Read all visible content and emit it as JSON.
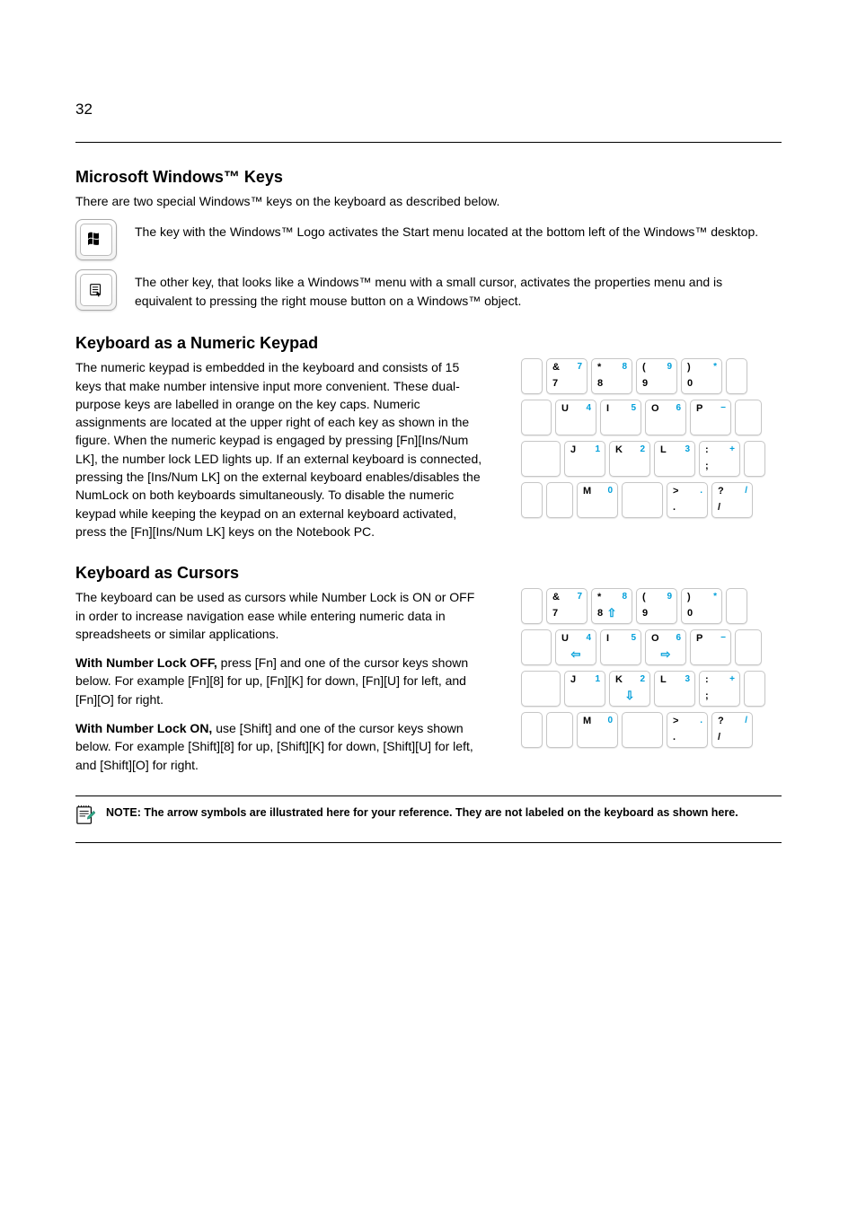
{
  "page_number": "32",
  "sections": {
    "ms_windows_keys": {
      "title": "Microsoft Windows™ Keys",
      "intro": "There are two special Windows™ keys on the keyboard as described below.",
      "win_key_text": "The key with the Windows™ Logo activates the Start menu located at the bottom left of the Windows™ desktop.",
      "menu_key_text": "The other key, that looks like a Windows™ menu with a small cursor, activates the properties menu and is equivalent to pressing the right mouse button on a Windows™ object."
    },
    "numeric_keypad": {
      "title": "Keyboard as a Numeric Keypad",
      "text": "The numeric keypad is embedded in the keyboard and consists of 15 keys that make number intensive input more convenient. These dual-purpose keys are labelled in orange on the key caps. Numeric assignments are located at the upper right of each key as shown in the figure. When the numeric keypad is engaged by pressing [Fn][Ins/Num LK], the number lock LED lights up. If an external keyboard is connected, pressing the [Ins/Num LK] on the external keyboard enables/disables the NumLock on both keyboards simultaneously. To disable the numeric keypad while keeping the keypad on an external keyboard activated, press the [Fn][Ins/Num LK] keys on the Notebook PC."
    },
    "cursors": {
      "title": "Keyboard as Cursors",
      "text": "The keyboard can be used as cursors while Number Lock is ON or OFF in order to increase navigation ease while entering numeric data in spreadsheets or similar applications.",
      "num_off": "With Number Lock OFF, press [Fn] and one of the cursor keys shown below. For example [Fn][8] for up, [Fn][K] for down, [Fn][U] for left, and [Fn][O] for right.",
      "num_on": "With Number Lock ON, use [Shift] and one of the cursor keys shown below. For example [Shift][8] for up, [Shift][K] for down, [Shift][U] for left, and [Shift][O] for right.",
      "num_off_label": "With Number Lock OFF,",
      "num_on_label": "With Number Lock ON,"
    },
    "note": {
      "text": "NOTE: The arrow symbols are illustrated here for your reference. They are not labeled on the keyboard as shown here."
    }
  },
  "keypad": {
    "row1": [
      {
        "top": "&",
        "main": "7",
        "alt": "7"
      },
      {
        "top": "*",
        "main": "8",
        "alt": "8"
      },
      {
        "top": "(",
        "main": "9",
        "alt": "9"
      },
      {
        "top": ")",
        "main": "0",
        "alt": "*"
      }
    ],
    "row2": [
      {
        "top": "U",
        "main": "",
        "alt": "4"
      },
      {
        "top": "I",
        "main": "",
        "alt": "5"
      },
      {
        "top": "O",
        "main": "",
        "alt": "6"
      },
      {
        "top": "P",
        "main": "",
        "alt": "−"
      }
    ],
    "row3": [
      {
        "top": "J",
        "main": "",
        "alt": "1"
      },
      {
        "top": "K",
        "main": "",
        "alt": "2"
      },
      {
        "top": "L",
        "main": "",
        "alt": "3"
      },
      {
        "top": ":",
        "main": ";",
        "alt": "+"
      }
    ],
    "row4": [
      {
        "top": "M",
        "main": "",
        "alt": "0"
      },
      {
        "top": ">",
        "main": ".",
        "alt": "."
      },
      {
        "top": "?",
        "main": "/",
        "alt": "/"
      }
    ]
  },
  "keypad_cursors": {
    "up_key": "8",
    "down_key": "K",
    "left_key": "U",
    "right_key": "O"
  }
}
